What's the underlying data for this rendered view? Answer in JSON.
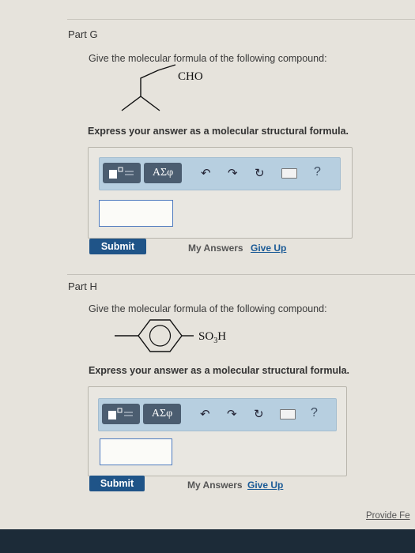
{
  "part_g": {
    "title": "Part G",
    "prompt": "Give the molecular formula of the following compound:",
    "substituent": "CHO",
    "express": "Express your answer as a molecular structural formula.",
    "toolbar": {
      "template_icon": "template-icon",
      "greek_label": "ΑΣφ",
      "undo_icon": "undo-icon",
      "redo_icon": "redo-icon",
      "reset_icon": "reset-icon",
      "keyboard_icon": "keyboard-icon",
      "help_label": "?"
    },
    "answer_value": "",
    "submit_label": "Submit",
    "my_answers_label": "My Answers",
    "give_up_label": "Give Up"
  },
  "part_h": {
    "title": "Part H",
    "prompt": "Give the molecular formula of the following compound:",
    "substituent_main": "SO",
    "substituent_sub": "3",
    "substituent_tail": "H",
    "express": "Express your answer as a molecular structural formula.",
    "toolbar": {
      "template_icon": "template-icon",
      "greek_label": "ΑΣφ",
      "undo_icon": "undo-icon",
      "redo_icon": "redo-icon",
      "reset_icon": "reset-icon",
      "keyboard_icon": "keyboard-icon",
      "help_label": "?"
    },
    "answer_value": "",
    "submit_label": "Submit",
    "my_answers_label": "My Answers",
    "give_up_label": "Give Up"
  },
  "footer": {
    "feedback_label": "Provide Fe"
  },
  "colors": {
    "toolbar_bg": "#b7cfe0",
    "button_dark": "#4b5d70",
    "submit_bg": "#1f5488",
    "link_blue": "#1a5a96"
  }
}
